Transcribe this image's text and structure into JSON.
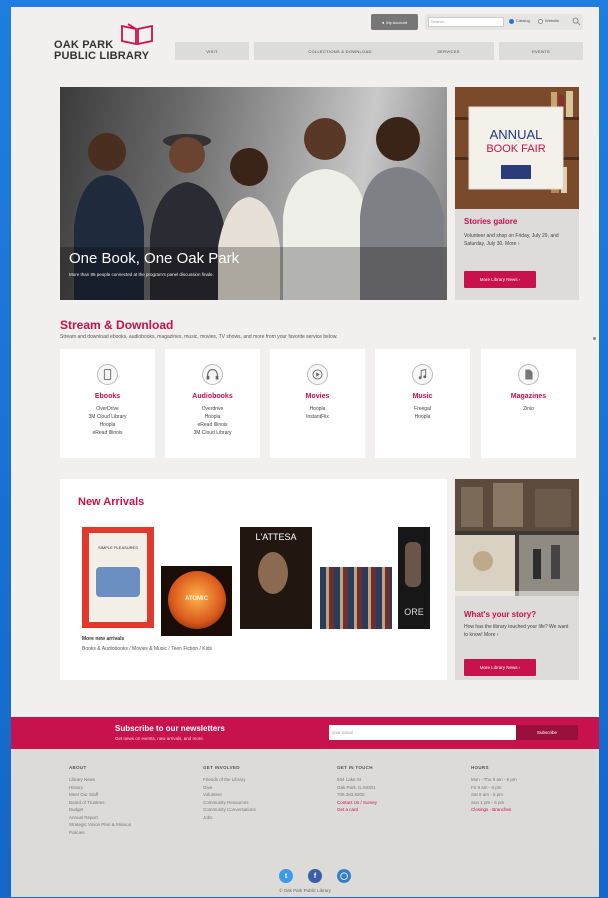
{
  "header": {
    "logo_line1": "OAK PARK",
    "logo_line2": "PUBLIC LIBRARY",
    "account_label": "My Account",
    "search_placeholder": "Search...",
    "search_opt1": "Catalog",
    "search_opt2": "Website",
    "nav": [
      "VISIT",
      "COLLECTIONS & DOWNLOAD",
      "SERVICES",
      "EVENTS"
    ]
  },
  "hero": {
    "title": "One Book, One Oak Park",
    "subtitle": "More than 85 people connected at the program's panel discussion finale."
  },
  "side_card": {
    "sign_line1": "ANNUAL",
    "sign_line2": "BOOK FAIR",
    "title": "Stories galore",
    "text": "Volunteer and shop on Friday, July 29, and Saturday, July 30. More ›",
    "button": "More Library News ›"
  },
  "stream": {
    "title": "Stream & Download",
    "subtitle": "Stream and download ebooks, audiobooks, magazines, music, movies, TV shows, and more from your favorite service below.",
    "cards": [
      {
        "title": "Ebooks",
        "items": [
          "OverDrive",
          "3M Cloud Library",
          "Hoopla",
          "eRead Illinois"
        ],
        "icon": "tablet-icon"
      },
      {
        "title": "Audiobooks",
        "items": [
          "Overdrive",
          "Hoopla",
          "eRead Illinois",
          "3M Cloud Library"
        ],
        "icon": "headphones-icon"
      },
      {
        "title": "Movies",
        "items": [
          "Hoopla",
          "InstantFlix"
        ],
        "icon": "play-icon"
      },
      {
        "title": "Music",
        "items": [
          "Freegal",
          "Hoopla"
        ],
        "icon": "music-note-icon"
      },
      {
        "title": "Magazines",
        "items": [
          "Zinio"
        ],
        "icon": "document-icon"
      }
    ]
  },
  "arrivals": {
    "title": "New Arrivals",
    "books": [
      "SIMPLE PLEASURES",
      "ATOMIC",
      "L'ATTESA",
      "",
      "ORE"
    ],
    "more_label": "More new arrivals",
    "links": "Books & Audiobooks / Movies & Music / Teen Fiction / Kids"
  },
  "story_card": {
    "title": "What's your story?",
    "text": "How has the library touched your life? We want to know! More ›",
    "button": "More Library News ›"
  },
  "newsletter": {
    "title": "Subscribe to our newsletters",
    "subtitle": "Get news on events, new arrivals, and more.",
    "placeholder": "your email",
    "button": "Subscribe"
  },
  "footer": {
    "about": {
      "head": "ABOUT",
      "links": [
        "Library News",
        "History",
        "Meet Our Staff",
        "Board of Trustees",
        "Budget",
        "Annual Report",
        "Strategic Vision Plan & Mission",
        "Policies"
      ]
    },
    "involved": {
      "head": "GET INVOLVED",
      "links": [
        "Friends of the Library",
        "Give",
        "Volunteer",
        "Community Resources",
        "Community Conversations",
        "Jobs"
      ]
    },
    "contact": {
      "head": "GET IN TOUCH",
      "lines": [
        "834 Lake St",
        "Oak Park, IL 60301",
        "708.383.8200"
      ],
      "red_links": [
        "Contact Us / Survey",
        "Get a card"
      ]
    },
    "hours": {
      "head": "HOURS",
      "lines": [
        "Mon - Thu 9 am - 9 pm",
        "Fri 9 am - 6 pm",
        "Sat 9 am - 5 pm",
        "Sun 1 pm - 6 pm"
      ],
      "red_links": [
        "Closings · Branches"
      ]
    },
    "copyright": "© Oak Park Public Library"
  },
  "colors": {
    "accent": "#c8124e",
    "bg": "#f1f0ee",
    "frame": "#1e7fe0"
  }
}
